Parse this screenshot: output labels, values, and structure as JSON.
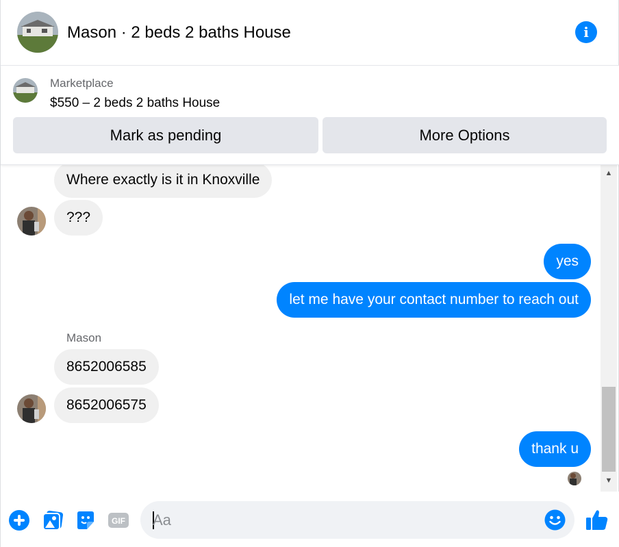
{
  "header": {
    "title": "Mason · 2 beds 2 baths House",
    "info_icon": "info-icon"
  },
  "marketplace": {
    "label": "Marketplace",
    "listing": "$550 – 2 beds 2 baths House",
    "mark_pending_label": "Mark as pending",
    "more_options_label": "More Options"
  },
  "messages": [
    {
      "direction": "in",
      "text": "Where exactly is it in Knoxville"
    },
    {
      "direction": "in",
      "text": "???"
    },
    {
      "direction": "out",
      "text": "yes"
    },
    {
      "direction": "out",
      "text": "let me have your contact number to reach out"
    },
    {
      "direction": "in",
      "sender": "Mason",
      "text": "8652006585"
    },
    {
      "direction": "in",
      "text": "8652006575"
    },
    {
      "direction": "out",
      "text": "thank u"
    }
  ],
  "composer": {
    "placeholder": "Aa",
    "icons": [
      "plus-icon",
      "photo-icon",
      "sticker-icon",
      "gif-icon",
      "emoji-icon",
      "like-icon"
    ],
    "gif_text": "GIF"
  },
  "colors": {
    "accent": "#0084ff",
    "incoming_bubble": "#f0f0f0",
    "button_gray": "#e4e6eb"
  }
}
